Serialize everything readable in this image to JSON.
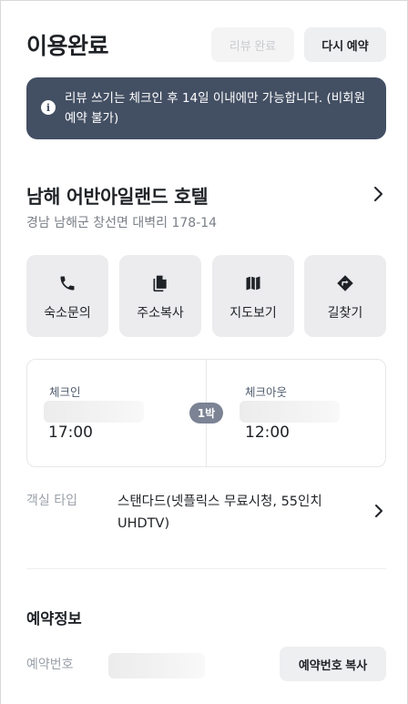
{
  "header": {
    "title": "이용완료",
    "review_button": "리뷰 완료",
    "rebook_button": "다시 예약"
  },
  "notice": {
    "text": "리뷰 쓰기는 체크인 후 14일 이내에만 가능합니다. (비회원예약 불가)",
    "icon": "info-icon"
  },
  "hotel": {
    "name": "남해 어반아일랜드 호텔",
    "address": "경남 남해군 창선면 대벽리 178-14"
  },
  "actions": [
    {
      "label": "숙소문의",
      "icon": "phone-icon"
    },
    {
      "label": "주소복사",
      "icon": "copy-icon"
    },
    {
      "label": "지도보기",
      "icon": "map-icon"
    },
    {
      "label": "길찾기",
      "icon": "directions-icon"
    }
  ],
  "stay": {
    "checkin_label": "체크인",
    "checkin_time": "17:00",
    "checkout_label": "체크아웃",
    "checkout_time": "12:00",
    "nights": "1박"
  },
  "room": {
    "label": "객실 타입",
    "value": "스탠다드(넷플릭스 무료시청, 55인치UHDTV)"
  },
  "reservation": {
    "section_title": "예약정보",
    "number_label": "예약번호",
    "copy_button": "예약번호 복사"
  },
  "colors": {
    "notice_bg": "#434f63",
    "badge_bg": "#7b8394",
    "button_bg": "#eeeff1",
    "action_bg": "#ececee"
  }
}
